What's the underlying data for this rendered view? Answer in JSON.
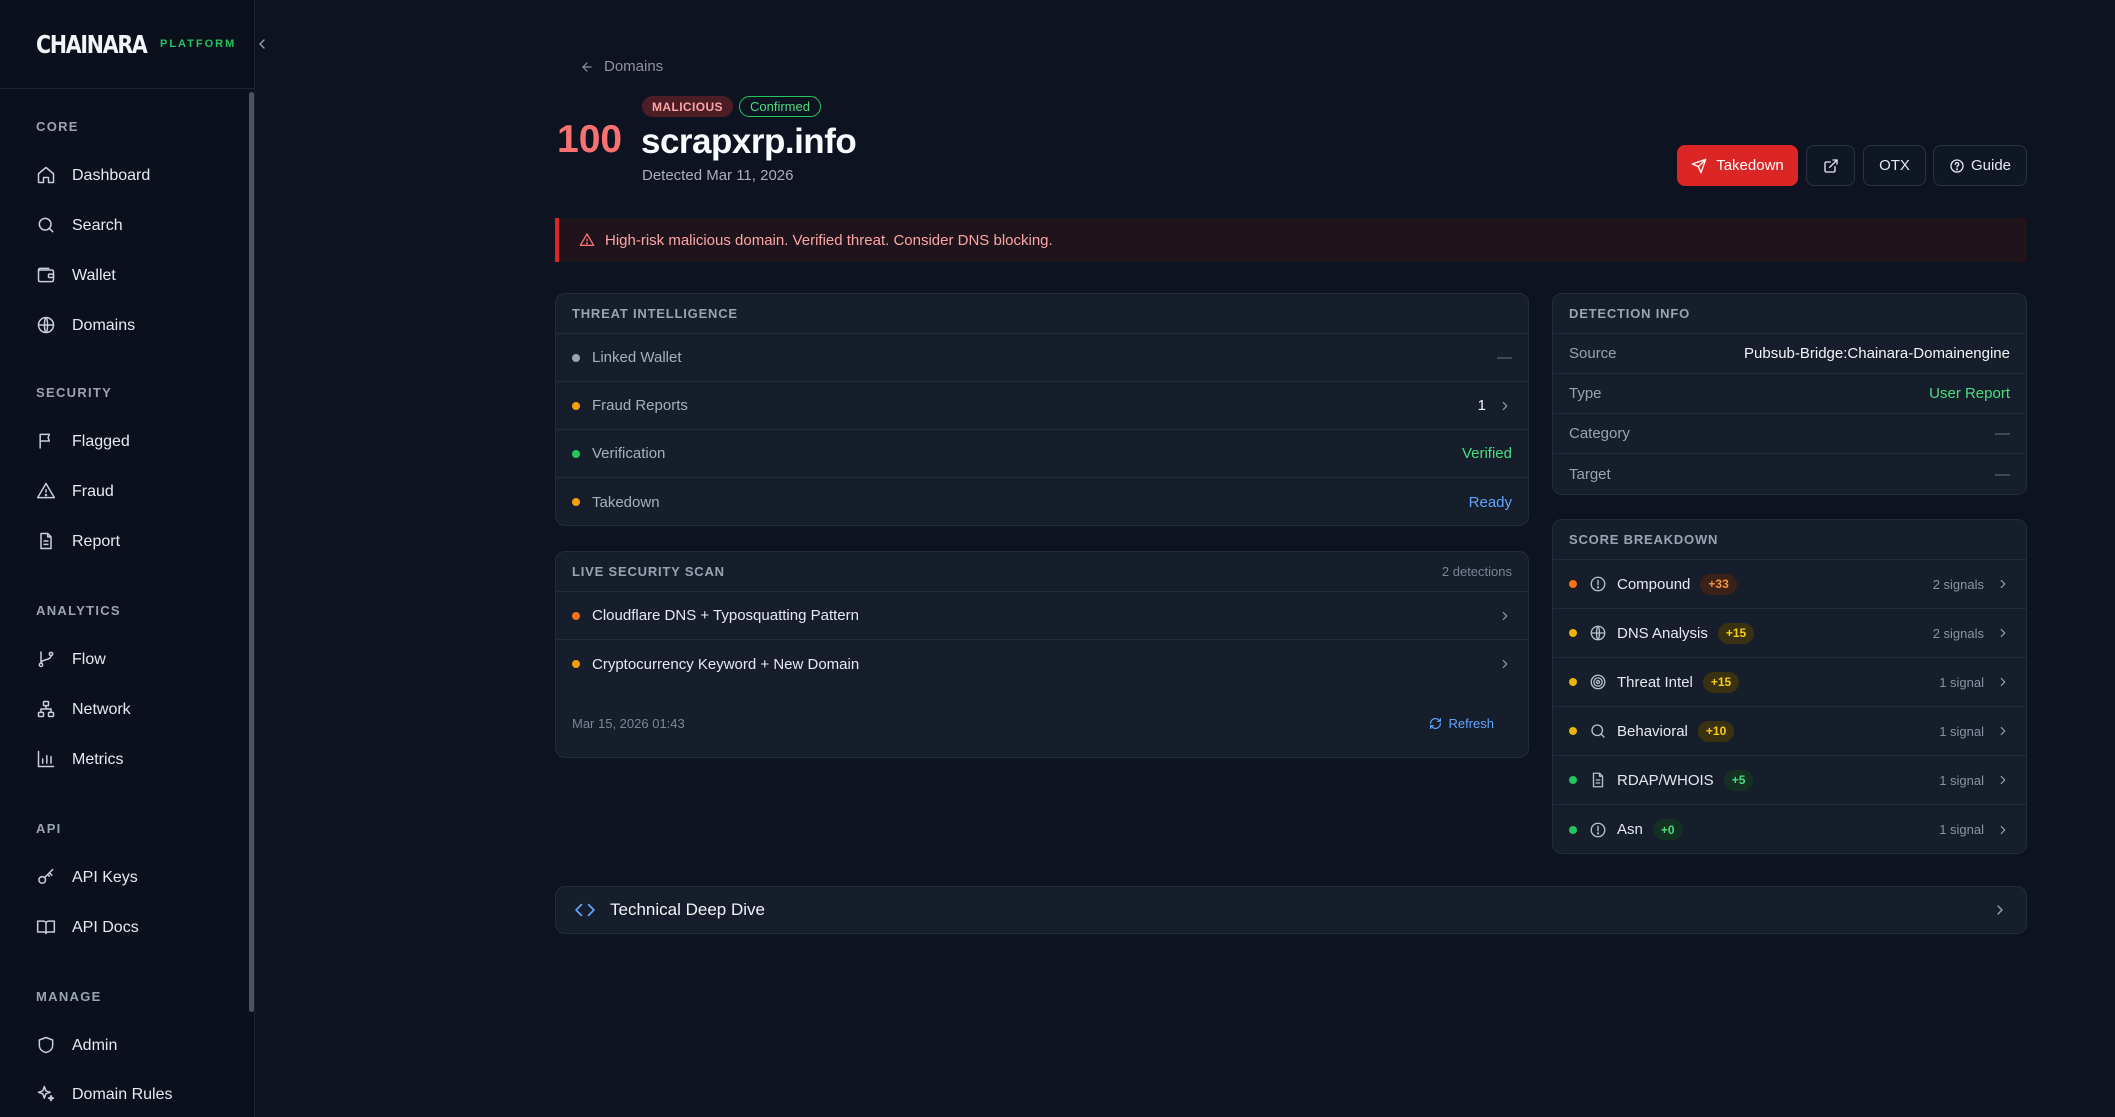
{
  "sidebar": {
    "brand": "CHAINARA",
    "brand_sub": "PLATFORM",
    "sections": {
      "core": "CORE",
      "security": "SECURITY",
      "analytics": "ANALYTICS",
      "api": "API",
      "manage": "MANAGE"
    },
    "items": {
      "dashboard": "Dashboard",
      "search": "Search",
      "wallet": "Wallet",
      "domains": "Domains",
      "flagged": "Flagged",
      "fraud": "Fraud",
      "report": "Report",
      "flow": "Flow",
      "network": "Network",
      "metrics": "Metrics",
      "api_keys": "API Keys",
      "api_docs": "API Docs",
      "admin": "Admin",
      "domain_rules": "Domain Rules"
    }
  },
  "header": {
    "breadcrumb": "Domains",
    "score": "100",
    "badge_malicious": "MALICIOUS",
    "badge_confirmed": "Confirmed",
    "domain": "scrapxrp.info",
    "detected": "Detected Mar 11, 2026"
  },
  "actions": {
    "takedown": "Takedown",
    "otx": "OTX",
    "guide": "Guide"
  },
  "alert": {
    "text": "High-risk malicious domain. Verified threat. Consider DNS blocking."
  },
  "threat_intel": {
    "title": "THREAT INTELLIGENCE",
    "rows": [
      {
        "label": "Linked Wallet",
        "value": "—",
        "dot": "#9ca3af",
        "value_color": "#6b7280"
      },
      {
        "label": "Fraud Reports",
        "value": "1",
        "dot": "#f59e0b",
        "value_color": "#f3f4f6"
      },
      {
        "label": "Verification",
        "value": "Verified",
        "dot": "#22c55e",
        "value_color": "#4ade80"
      },
      {
        "label": "Takedown",
        "value": "Ready",
        "dot": "#f59e0b",
        "value_color": "#60a5fa"
      }
    ]
  },
  "scan": {
    "title": "LIVE SECURITY SCAN",
    "detections": "2 detections",
    "items": [
      {
        "label": "Cloudflare DNS + Typosquatting Pattern",
        "dot": "#f97316"
      },
      {
        "label": "Cryptocurrency Keyword + New Domain",
        "dot": "#f59e0b"
      }
    ],
    "timestamp": "Mar 15, 2026 01:43",
    "refresh": "Refresh"
  },
  "detection": {
    "title": "DETECTION INFO",
    "rows": [
      {
        "label": "Source",
        "value": "Pubsub-Bridge:Chainara-Domainengine",
        "value_color": "#f3f4f6"
      },
      {
        "label": "Type",
        "value": "User Report",
        "value_color": "#4ade80"
      },
      {
        "label": "Category",
        "value": "—",
        "value_color": "#6b7280"
      },
      {
        "label": "Target",
        "value": "—",
        "value_color": "#6b7280"
      }
    ]
  },
  "score_breakdown": {
    "title": "SCORE BREAKDOWN",
    "rows": [
      {
        "label": "Compound",
        "score": "+33",
        "signals": "2 signals",
        "dot": "#f97316",
        "icon": "alert-circle-icon",
        "pill_bg": "#3b2218",
        "pill_fg": "#fb923c"
      },
      {
        "label": "DNS Analysis",
        "score": "+15",
        "signals": "2 signals",
        "dot": "#eab308",
        "icon": "globe-icon",
        "pill_bg": "#3a3112",
        "pill_fg": "#facc15"
      },
      {
        "label": "Threat Intel",
        "score": "+15",
        "signals": "1 signal",
        "dot": "#eab308",
        "icon": "target-icon",
        "pill_bg": "#3a3112",
        "pill_fg": "#facc15"
      },
      {
        "label": "Behavioral",
        "score": "+10",
        "signals": "1 signal",
        "dot": "#eab308",
        "icon": "search-icon",
        "pill_bg": "#3a3112",
        "pill_fg": "#facc15"
      },
      {
        "label": "RDAP/WHOIS",
        "score": "+5",
        "signals": "1 signal",
        "dot": "#22c55e",
        "icon": "file-icon",
        "pill_bg": "#143023",
        "pill_fg": "#4ade80"
      },
      {
        "label": "Asn",
        "score": "+0",
        "signals": "1 signal",
        "dot": "#22c55e",
        "icon": "alert-circle-icon",
        "pill_bg": "#143023",
        "pill_fg": "#4ade80"
      }
    ]
  },
  "deep_dive": {
    "label": "Technical Deep Dive"
  }
}
